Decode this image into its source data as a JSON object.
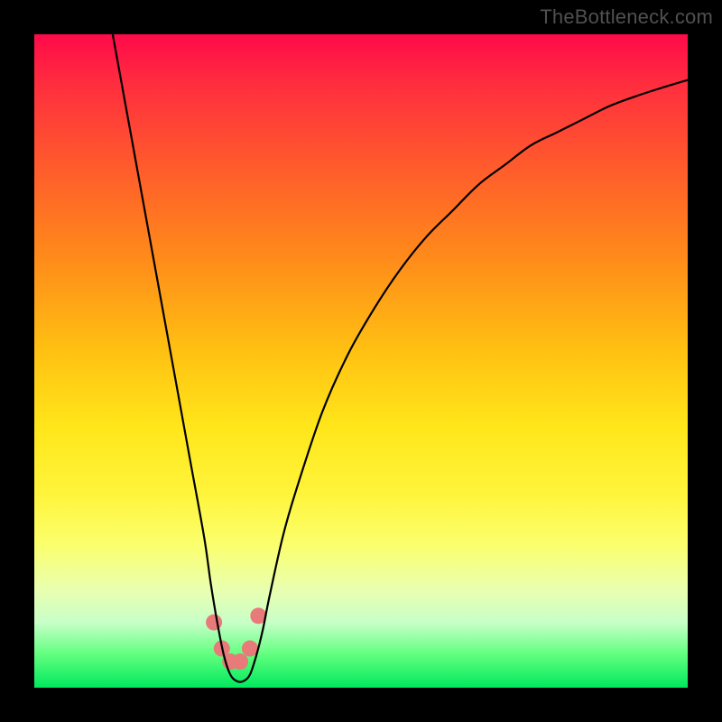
{
  "watermark": {
    "text": "TheBottleneck.com"
  },
  "chart_data": {
    "type": "line",
    "title": "",
    "xlabel": "",
    "ylabel": "",
    "xlim": [
      0,
      100
    ],
    "ylim": [
      0,
      100
    ],
    "grid": false,
    "series": [
      {
        "name": "curve",
        "x": [
          12,
          14,
          16,
          18,
          20,
          22,
          24,
          26,
          27,
          28,
          29,
          30,
          31,
          32,
          33,
          34,
          35,
          36,
          38,
          40,
          44,
          48,
          52,
          56,
          60,
          64,
          68,
          72,
          76,
          80,
          84,
          88,
          92,
          96,
          100
        ],
        "values": [
          100,
          89,
          78,
          67,
          56,
          45,
          34,
          23,
          16,
          10,
          5,
          2,
          1,
          1,
          2,
          5,
          9,
          14,
          23,
          30,
          42,
          51,
          58,
          64,
          69,
          73,
          77,
          80,
          83,
          85,
          87,
          89,
          90.5,
          91.8,
          93
        ]
      }
    ],
    "markers": [
      {
        "x": 27.5,
        "y": 10
      },
      {
        "x": 28.7,
        "y": 6
      },
      {
        "x": 30.0,
        "y": 4
      },
      {
        "x": 31.5,
        "y": 4
      },
      {
        "x": 33.0,
        "y": 6
      },
      {
        "x": 34.3,
        "y": 11
      }
    ],
    "marker_style": {
      "color": "#e97a7a",
      "radius_px": 9
    }
  }
}
